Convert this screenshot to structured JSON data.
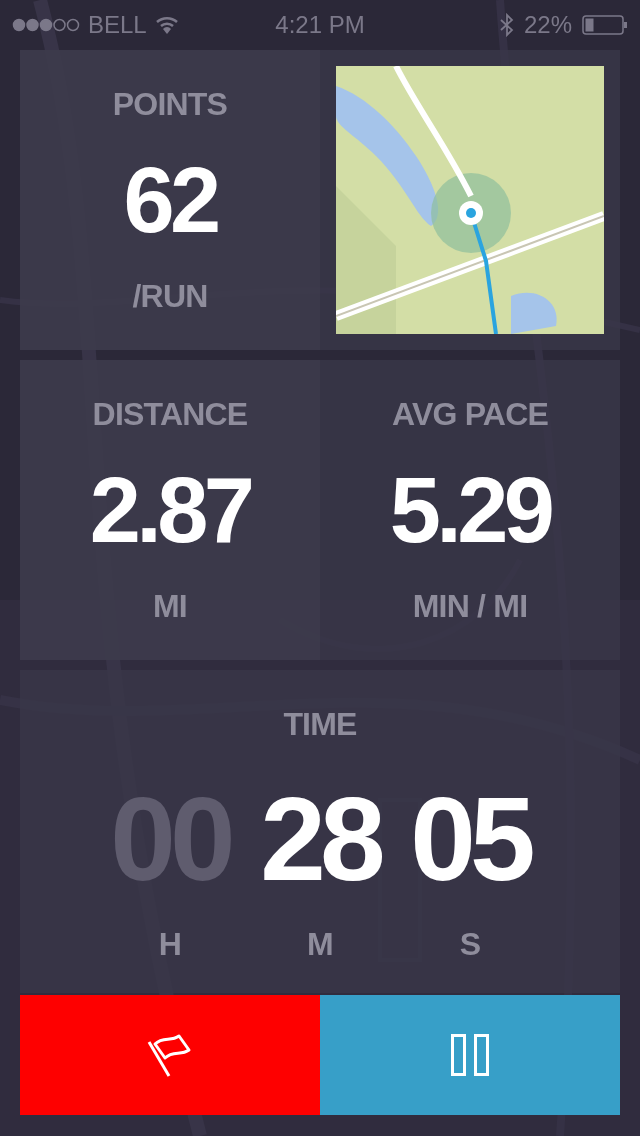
{
  "status_bar": {
    "carrier": "BELL",
    "time": "4:21 PM",
    "battery": "22%"
  },
  "points": {
    "label": "POINTS",
    "value": "62",
    "unit": "/RUN"
  },
  "stats": [
    {
      "label": "DISTANCE",
      "value": "2.87",
      "unit": "MI"
    },
    {
      "label": "AVG PACE",
      "value": "5.29",
      "unit": "MIN / MI"
    }
  ],
  "time": {
    "label": "TIME",
    "parts": [
      {
        "value": "00",
        "unit": "H",
        "active": false
      },
      {
        "value": "28",
        "unit": "M",
        "active": true
      },
      {
        "value": "05",
        "unit": "S",
        "active": true
      }
    ]
  }
}
